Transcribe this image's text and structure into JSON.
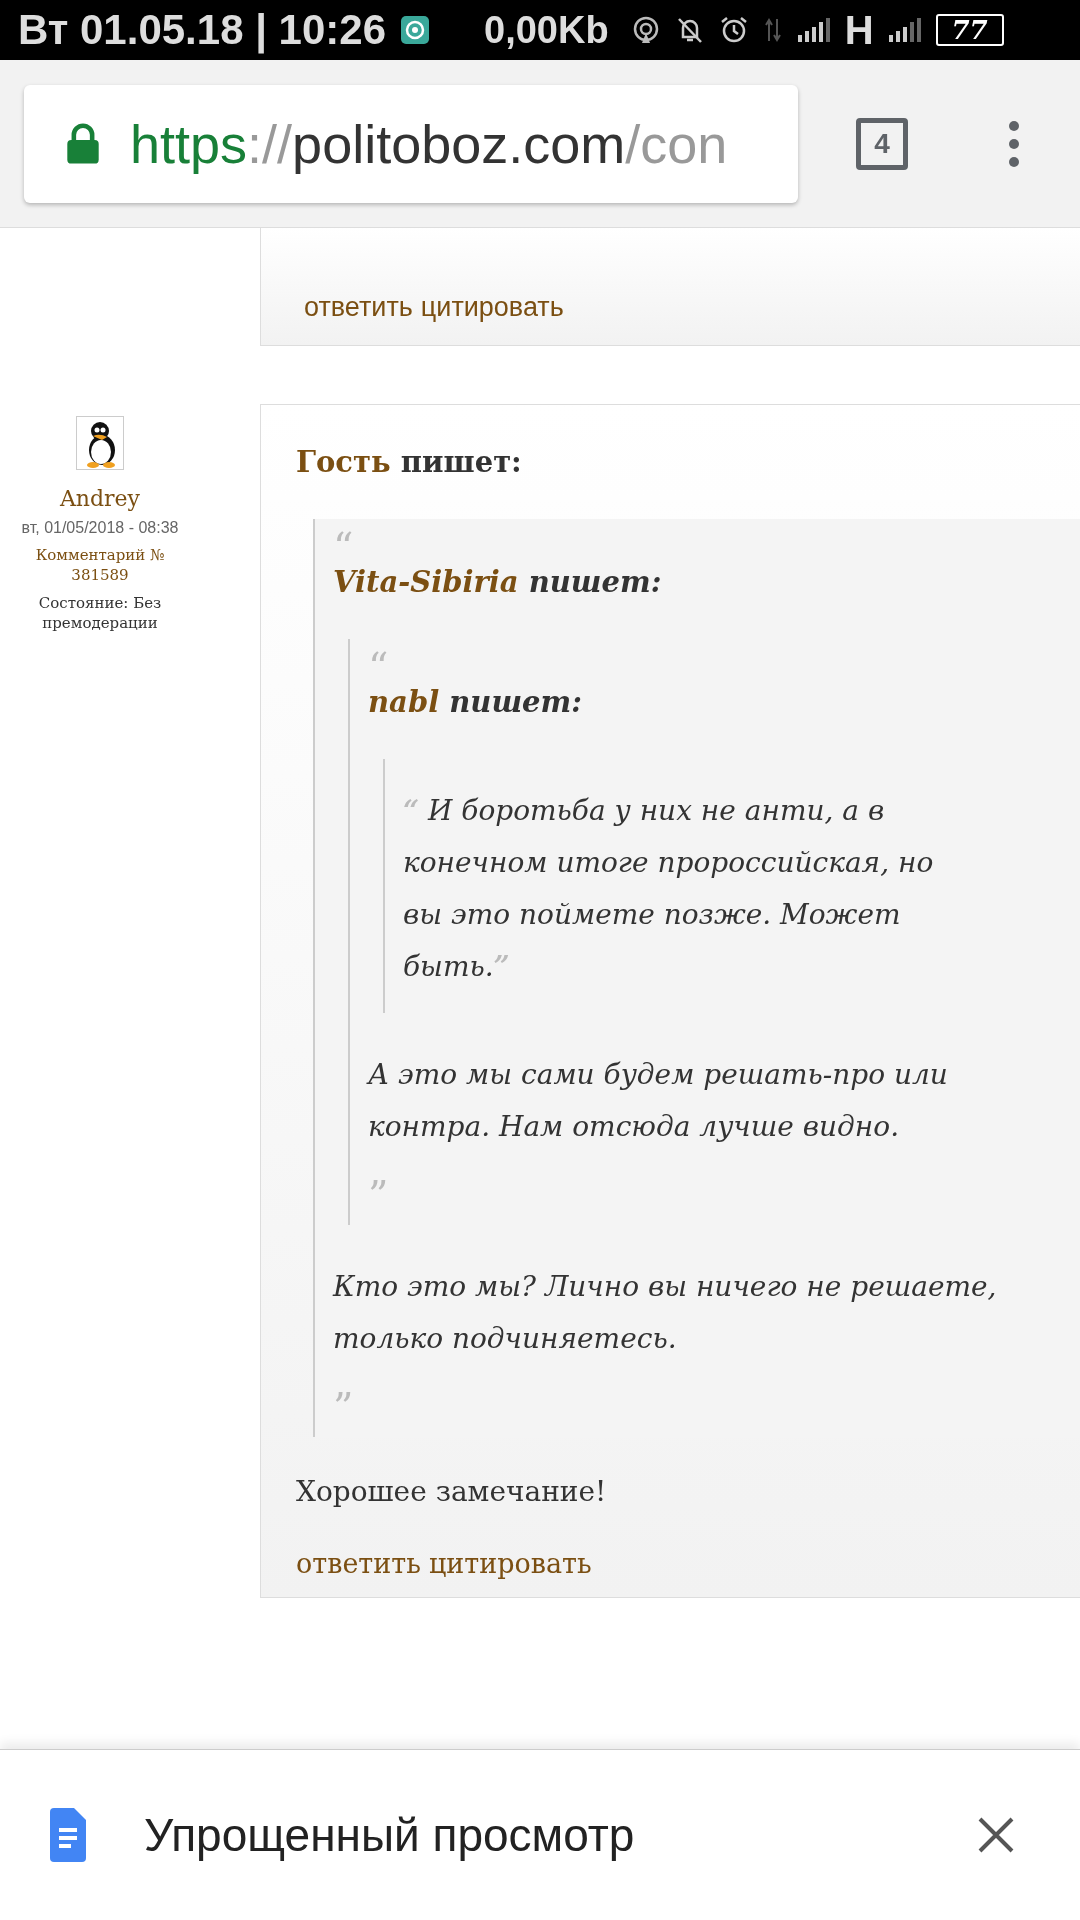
{
  "status_bar": {
    "datetime": "Вт 01.05.18 | 10:26",
    "data_rate": "0,00Kb",
    "network_type": "H",
    "battery": "77"
  },
  "browser": {
    "url_scheme": "https",
    "url_separator": "://",
    "url_host": "politoboz.com",
    "url_path": "/con",
    "tab_count": "4"
  },
  "comments": [
    {
      "kind": "partial",
      "actions": [
        "ответить",
        "цитировать"
      ]
    },
    {
      "kind": "full",
      "author": "Andrey",
      "date": "вт, 01/05/2018 - 08:38",
      "comment_number": "Комментарий № 381589",
      "state": "Состояние: Без премодерации",
      "quote_author": "Гость",
      "writes_label": "пишет:",
      "quote": {
        "open_mark": "“",
        "author": "Vita-Sibiria",
        "writes_label": "пишет:",
        "quote": {
          "open_mark": "“",
          "author": "nabl",
          "writes_label": "пишет:",
          "quote": {
            "open_mark": "“",
            "text": "И боротьба у них не анти, а в конечном итоге пророссийская, но вы это поймете позже. Может быть.",
            "close_mark": "”"
          },
          "text": "А это мы сами будем решать-про или контра. Нам отсюда лучше видно.",
          "close_mark": "”"
        },
        "text": "Кто это мы? Лично вы ничего не решаете, только подчиняетесь.",
        "close_mark": "”"
      },
      "text": "Хорошее замечание!",
      "actions": [
        "ответить",
        "цитировать"
      ]
    }
  ],
  "reader_mode_bar": {
    "label": "Упрощенный просмотр"
  }
}
